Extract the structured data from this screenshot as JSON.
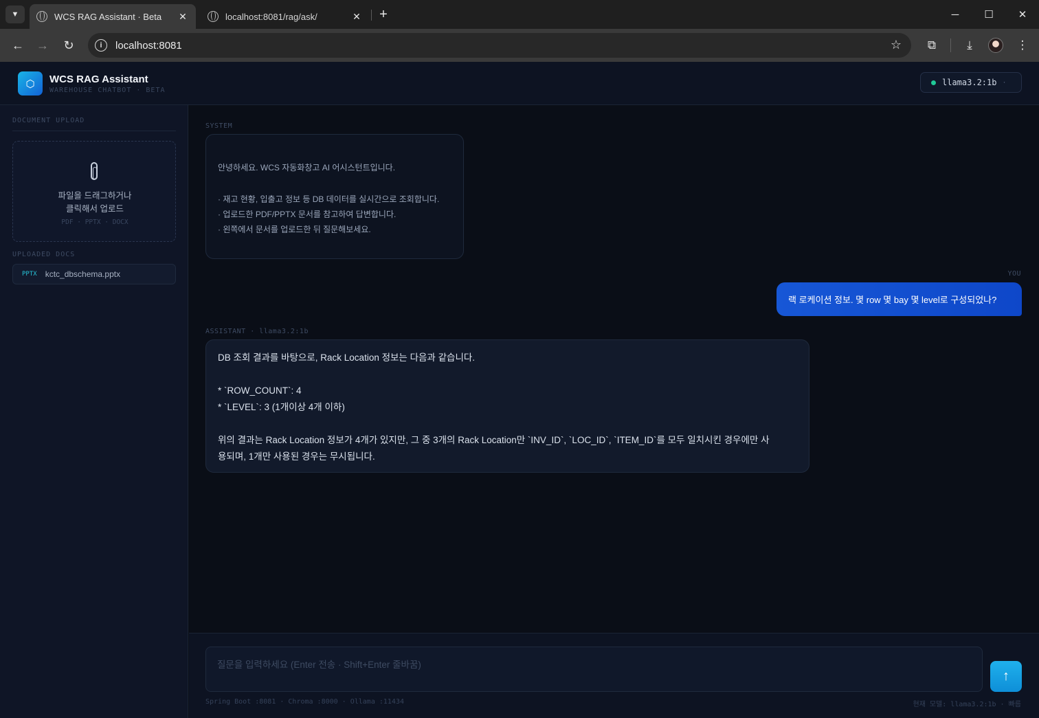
{
  "browser": {
    "tabs": [
      {
        "title": "WCS RAG Assistant · Beta",
        "active": true
      },
      {
        "title": "localhost:8081/rag/ask/",
        "active": false
      }
    ],
    "url": "localhost:8081"
  },
  "header": {
    "title": "WCS RAG Assistant",
    "subtitle": "WAREHOUSE CHATBOT · BETA",
    "model": "llama3.2:1b"
  },
  "sidebar": {
    "upload_label": "DOCUMENT UPLOAD",
    "dropzone_line1": "파일을 드래그하거나",
    "dropzone_line2": "클릭해서 업로드",
    "dropzone_formats": "PDF · PPTX · DOCX",
    "uploaded_label": "UPLOADED DOCS",
    "docs": [
      {
        "type": "PPTX",
        "name": "kctc_dbschema.pptx"
      }
    ]
  },
  "chat": {
    "system_label": "SYSTEM",
    "system_lines": [
      "안녕하세요. WCS 자동화창고 AI 어시스턴트입니다.",
      "· 재고 현황, 입출고 정보 등 DB 데이터를 실시간으로 조회합니다.",
      "· 업로드한 PDF/PPTX 문서를 참고하여 답변합니다.",
      "· 왼쪽에서 문서를 업로드한 뒤 질문해보세요."
    ],
    "user_label": "YOU",
    "user_message": "랙 로케이션 정보. 몇 row 몇 bay 몇 level로 구성되었나?",
    "assistant_label": "ASSISTANT · llama3.2:1b",
    "assistant_lines": [
      "DB 조회 결과를 바탕으로, Rack Location 정보는 다음과 같습니다.",
      "*   `ROW_COUNT`: 4",
      "*   `LEVEL`: 3 (1개이상 4개 이하)",
      "위의 결과는 Rack Location 정보가 4개가 있지만, 그 중 3개의 Rack Location만 `INV_ID`, `LOC_ID`, `ITEM_ID`를 모두 일치시킨 경우에만 사",
      "용되며, 1개만 사용된 경우는 무시됩니다."
    ]
  },
  "composer": {
    "placeholder": "질문을 입력하세요 (Enter 전송 · Shift+Enter 줄바꿈)",
    "status_left": "Spring Boot :8081 · Chroma :8000 · Ollama :11434",
    "status_right": "현재 모델: llama3.2:1b · 빠름"
  }
}
